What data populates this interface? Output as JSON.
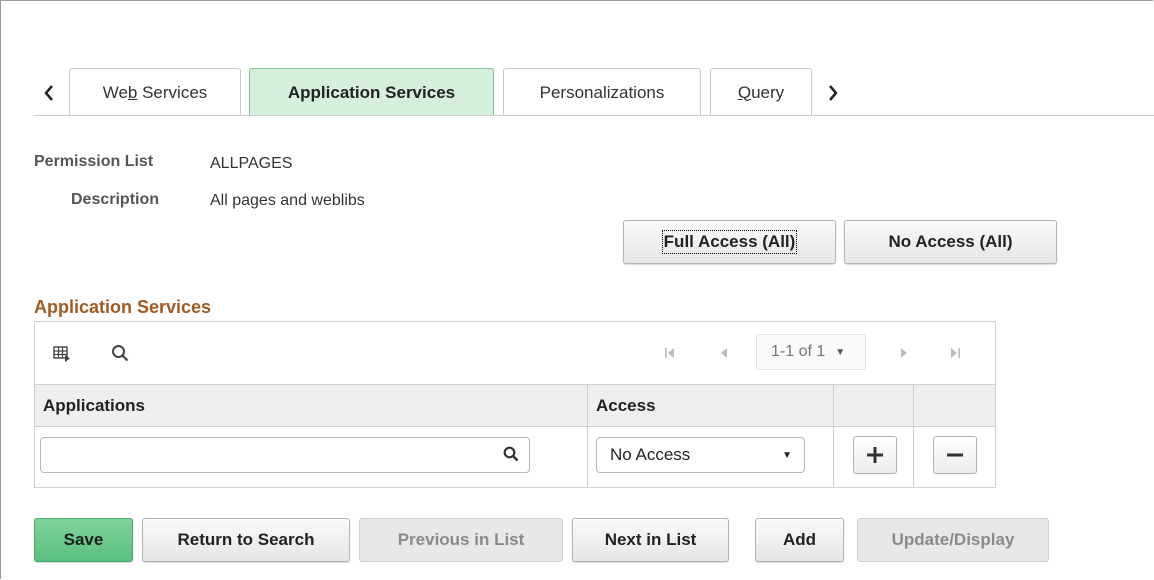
{
  "tabs": [
    {
      "label_pre": "We",
      "label_ul": "b",
      "label_post": " Services"
    },
    {
      "label": "Application Services"
    },
    {
      "label": "Personalizations"
    },
    {
      "label_ul": "Q",
      "label_post": "uery"
    }
  ],
  "header": {
    "permission_list_label": "Permission List",
    "permission_list_value": "ALLPAGES",
    "description_label": "Description",
    "description_value": "All pages and weblibs"
  },
  "actions": {
    "full_access": "Full Access (All)",
    "no_access": "No Access (All)"
  },
  "section": {
    "title": "Application Services"
  },
  "grid": {
    "pager": "1-1 of 1",
    "columns": [
      "Applications",
      "Access"
    ],
    "rows": [
      {
        "application": "",
        "access": "No Access"
      }
    ]
  },
  "footer": {
    "save": "Save",
    "return_to_search": "Return to Search",
    "previous_in_list": "Previous in List",
    "next_in_list": "Next in List",
    "add": "Add",
    "update_display": "Update/Display"
  },
  "colors": {
    "active_tab_bg": "#d6f0dd",
    "section_title": "#a05a23",
    "save_button": "#5bbf7f"
  }
}
